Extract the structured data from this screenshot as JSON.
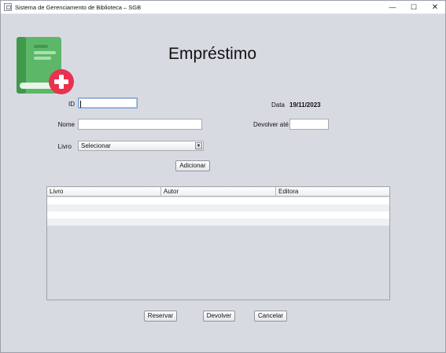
{
  "window": {
    "title": "Sistema de Gerenciamento de Biblioteca – SGB",
    "minimize_glyph": "—",
    "maximize_glyph": "☐",
    "close_glyph": "✕"
  },
  "logo": {
    "icon": "book-add-icon",
    "colors": {
      "book": "#5cb868",
      "book_dark": "#3f9a4c",
      "badge": "#e8324f"
    }
  },
  "heading": "Empréstimo",
  "form": {
    "id_label": "ID",
    "id_value": "",
    "nome_label": "Nome",
    "nome_value": "",
    "livro_label": "Livro",
    "livro_selected": "Selecionar",
    "data_label": "Data",
    "data_value": "19/11/2023",
    "devolver_ate_label": "Devolver até",
    "devolver_ate_value": "",
    "add_button": "Adicionar"
  },
  "table": {
    "columns": [
      "Livro",
      "Autor",
      "Editora"
    ],
    "rows": [
      [
        "",
        "",
        ""
      ],
      [
        "",
        "",
        ""
      ],
      [
        "",
        "",
        ""
      ],
      [
        "",
        "",
        ""
      ]
    ]
  },
  "actions": {
    "reservar": "Reservar",
    "devolver": "Devolver",
    "cancelar": "Cancelar"
  }
}
